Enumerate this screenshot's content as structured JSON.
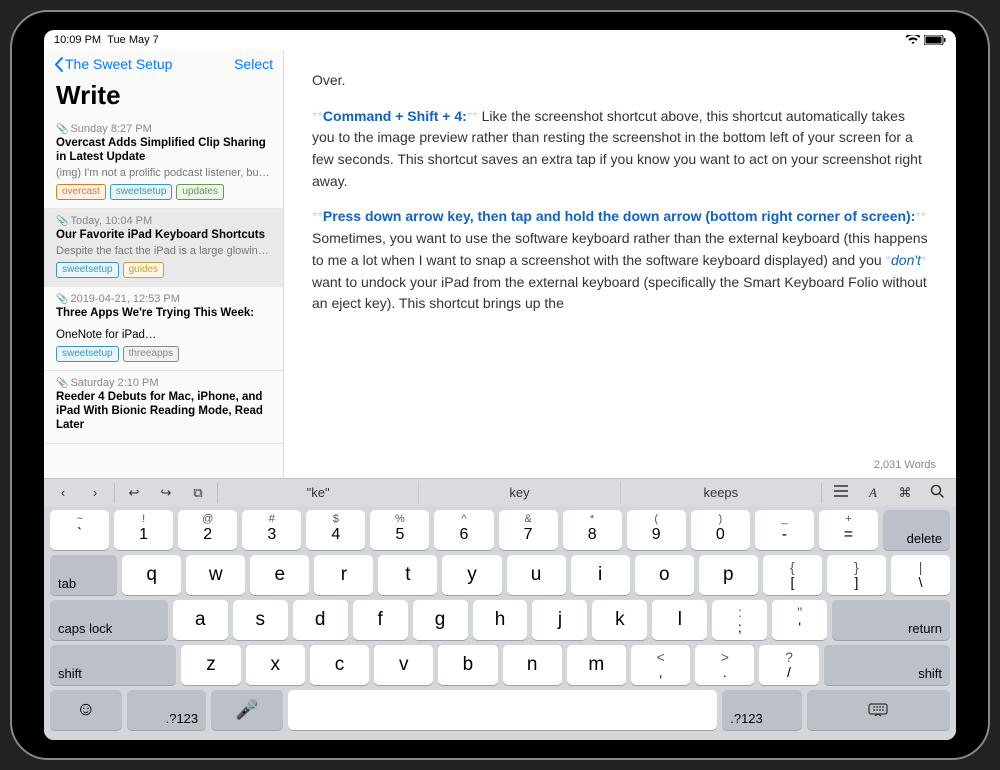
{
  "status": {
    "time": "10:09 PM",
    "date": "Tue May 7"
  },
  "sidebar": {
    "back_label": "The Sweet Setup",
    "select_label": "Select",
    "title": "Write",
    "notes": [
      {
        "date": "Sunday 8:27 PM",
        "title": "Overcast Adds Simplified Clip Sharing in Latest Update",
        "preview": "(img) I'm not a prolific podcast listener, but it…",
        "tags": [
          {
            "label": "overcast",
            "fg": "#d47b2e",
            "bg": "#fbf1e5"
          },
          {
            "label": "sweetsetup",
            "fg": "#3a99b8",
            "bg": "#e8f5f9"
          },
          {
            "label": "updates",
            "fg": "#6a9655",
            "bg": "#edf6e8"
          }
        ]
      },
      {
        "date": "Today, 10:04 PM",
        "title": "Our Favorite iPad Keyboard Shortcuts",
        "preview": "Despite the fact the iPad is a large glowing touchscreen, it almost feels like it was built to…",
        "tags": [
          {
            "label": "sweetsetup",
            "fg": "#3a99b8",
            "bg": "#e8f5f9"
          },
          {
            "label": "guides",
            "fg": "#c7a23a",
            "bg": "#fbf6e6"
          }
        ],
        "selected": true
      },
      {
        "date": "2019-04-21, 12:53 PM",
        "title": "Three Apps We're Trying This Week:",
        "preview": " ",
        "subtitle": "OneNote for iPad…",
        "tags": [
          {
            "label": "sweetsetup",
            "fg": "#3a99b8",
            "bg": "#e8f5f9"
          },
          {
            "label": "threeapps",
            "fg": "#888",
            "bg": "#f1f1f1"
          }
        ]
      },
      {
        "date": "Saturday 2:10 PM",
        "title": "Reeder 4 Debuts for Mac, iPhone, and iPad With Bionic Reading Mode, Read Later",
        "preview": "",
        "tags": []
      }
    ]
  },
  "editor": {
    "p0": "Over.",
    "shortcut1": "Command + Shift + 4:",
    "body1": " Like the screenshot shortcut above, this shortcut automatically takes you to the image preview rather than resting the screenshot in the bottom left of your screen for a few seconds. This shortcut saves an extra tap if you know you want to act on your screenshot right away.",
    "shortcut2": "Press down arrow key, then tap and hold the down arrow (bottom right corner of screen):",
    "body2a": " Sometimes, you want to use the software keyboard rather than the external keyboard (this happens to me a lot when I want to snap a screenshot with the software keyboard displayed) and you ",
    "dont": "don't",
    "body2b": " want to undock your iPad from the external keyboard (specifically the Smart Keyboard Folio without an eject key). This shortcut brings up the",
    "word_count": "2,031 Words"
  },
  "toolbar": {
    "suggestions": [
      "\"ke\"",
      "key",
      "keeps"
    ]
  },
  "keyboard": {
    "row1": [
      {
        "u": "~",
        "l": "`"
      },
      {
        "u": "!",
        "l": "1"
      },
      {
        "u": "@",
        "l": "2"
      },
      {
        "u": "#",
        "l": "3"
      },
      {
        "u": "$",
        "l": "4"
      },
      {
        "u": "%",
        "l": "5"
      },
      {
        "u": "^",
        "l": "6"
      },
      {
        "u": "&",
        "l": "7"
      },
      {
        "u": "*",
        "l": "8"
      },
      {
        "u": "(",
        "l": "9"
      },
      {
        "u": ")",
        "l": "0"
      },
      {
        "u": "_",
        "l": "-"
      },
      {
        "u": "+",
        "l": "="
      }
    ],
    "delete": "delete",
    "tab": "tab",
    "row2": [
      "q",
      "w",
      "e",
      "r",
      "t",
      "y",
      "u",
      "i",
      "o",
      "p"
    ],
    "row2p": [
      {
        "u": "{",
        "l": "["
      },
      {
        "u": "}",
        "l": "]"
      },
      {
        "u": "|",
        "l": "\\"
      }
    ],
    "caps": "caps lock",
    "row3": [
      "a",
      "s",
      "d",
      "f",
      "g",
      "h",
      "j",
      "k",
      "l"
    ],
    "row3p": [
      {
        "u": ":",
        "l": ";"
      },
      {
        "u": "\"",
        "l": "'"
      }
    ],
    "return": "return",
    "shift": "shift",
    "row4": [
      "z",
      "x",
      "c",
      "v",
      "b",
      "n",
      "m"
    ],
    "row4p": [
      {
        "u": "<",
        "l": ","
      },
      {
        "u": ">",
        "l": "."
      },
      {
        "u": "?",
        "l": "/"
      }
    ],
    "numkey": ".?123"
  }
}
